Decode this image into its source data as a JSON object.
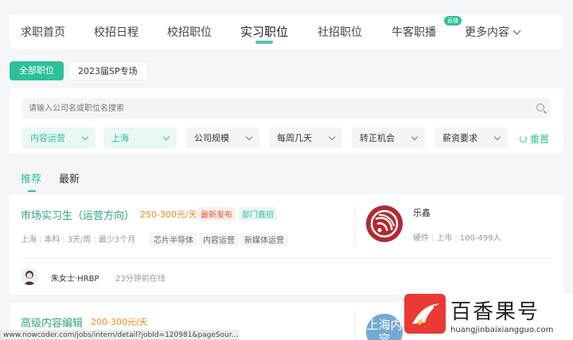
{
  "nav": {
    "items": [
      "求职首页",
      "校招日程",
      "校招职位",
      "实习职位",
      "社招职位",
      "牛客职播",
      "更多内容"
    ],
    "active": "实习职位",
    "live_badge": "直播"
  },
  "chips": [
    "全部职位",
    "2023届SP专场"
  ],
  "search": {
    "placeholder": "请输入公司名或职位名搜索"
  },
  "filters": [
    "内容运营",
    "上海",
    "公司规模",
    "每周几天",
    "转正机会",
    "薪资要求"
  ],
  "reset_label": "重置",
  "tabs": [
    "推荐",
    "最新"
  ],
  "jobs": [
    {
      "title": "市场实习生（运营方向）",
      "salary": "250-300元/天",
      "tags": [
        "最新发布",
        "部门直招"
      ],
      "meta": [
        "上海",
        "本科",
        "3天/周",
        "最少3个月"
      ],
      "skills": [
        "芯片半导体",
        "内容运营",
        "新媒体运营"
      ],
      "company": {
        "name": "乐鑫",
        "industry": "硬件",
        "stage": "上市",
        "size": "100-499人"
      },
      "recruiter": {
        "name": "朱女士·HRBP",
        "online": "23分钟前在线"
      }
    },
    {
      "title": "高级内容编辑",
      "salary": "200-300元/天",
      "company_logo_text": "上海内容"
    }
  ],
  "statusbar": "www.nowcoder.com/jobs/intern/detail?jobId=120981&pageSour...",
  "watermark": {
    "title": "百香果号",
    "domain": "huangjinbaixiangguo.com"
  }
}
